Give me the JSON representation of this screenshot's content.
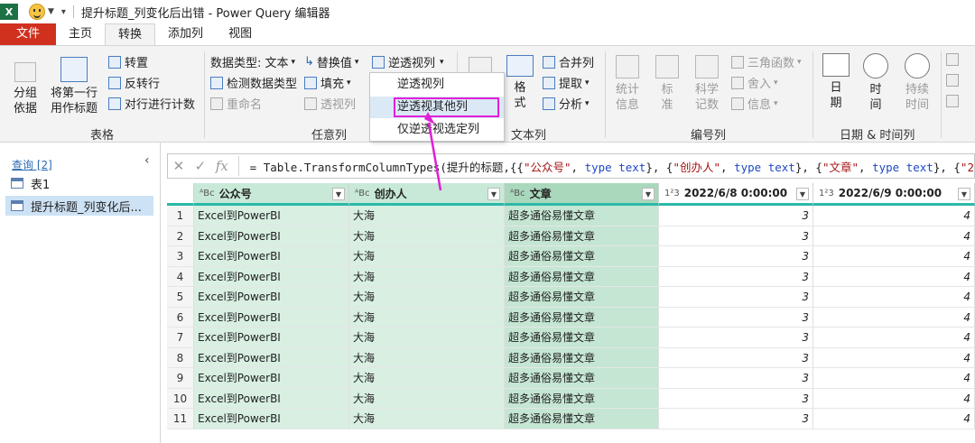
{
  "window": {
    "title": "提升标题_列变化后出错 - Power Query 编辑器",
    "app_logo": "X"
  },
  "tabs": [
    "文件",
    "主页",
    "转换",
    "添加列",
    "视图"
  ],
  "ribbon": {
    "table_group": {
      "label": "表格",
      "group_by": "分组\n依据",
      "use_first_row": "将第一行\n用作标题",
      "transpose": "转置",
      "reverse_rows": "反转行",
      "count_rows": "对行进行计数"
    },
    "any_column_group": {
      "label": "任意列",
      "data_type": "数据类型: 文本",
      "replace_values": "替换值",
      "unpivot_columns": "逆透视列",
      "detect_type": "检测数据类型",
      "fill": "填充",
      "rename": "重命名",
      "pivot": "透视列"
    },
    "text_group": {
      "label": "文本列",
      "format": "格\n式",
      "merge_columns": "合并列",
      "extract": "提取",
      "parse": "分析"
    },
    "number_group": {
      "label": "编号列",
      "statistics": "统计\n信息",
      "standard": "标\n准",
      "scientific": "科学\n记数",
      "trigonometry": "三角函数",
      "rounding": "舍入",
      "information": "信息"
    },
    "datetime_group": {
      "label": "日期 & 时间列",
      "date": "日\n期",
      "time": "时\n间",
      "duration": "持续\n时间"
    }
  },
  "dropdown_menu": {
    "items": [
      "逆透视列",
      "逆透视其他列",
      "仅逆透视选定列"
    ],
    "highlighted_index": 1
  },
  "queries_pane": {
    "title": "查询 [2]",
    "items": [
      "表1",
      "提升标题_列变化后..."
    ],
    "selected_index": 1
  },
  "formula_bar": {
    "prefix": "= Table.TransformColumnTypes(提升的标题,{{",
    "segments": [
      {
        "t": "\"公众号\"",
        "c": "str"
      },
      {
        "t": ", ",
        "c": ""
      },
      {
        "t": "type",
        "c": "kw"
      },
      {
        "t": " ",
        "c": ""
      },
      {
        "t": "text",
        "c": "kw"
      },
      {
        "t": "}, {",
        "c": ""
      },
      {
        "t": "\"创办人\"",
        "c": "str"
      },
      {
        "t": ", ",
        "c": ""
      },
      {
        "t": "type",
        "c": "kw"
      },
      {
        "t": " ",
        "c": ""
      },
      {
        "t": "text",
        "c": "kw"
      },
      {
        "t": "}, {",
        "c": ""
      },
      {
        "t": "\"文章\"",
        "c": "str"
      },
      {
        "t": ", ",
        "c": ""
      },
      {
        "t": "type",
        "c": "kw"
      },
      {
        "t": " ",
        "c": ""
      },
      {
        "t": "text",
        "c": "kw"
      },
      {
        "t": "}, {",
        "c": ""
      },
      {
        "t": "\"2",
        "c": "str"
      }
    ]
  },
  "table": {
    "columns": [
      {
        "name": "公众号",
        "type": "ABC",
        "state": "green"
      },
      {
        "name": "创办人",
        "type": "ABC",
        "state": "green"
      },
      {
        "name": "文章",
        "type": "ABC",
        "state": "sel"
      },
      {
        "name": "2022/6/8 0:00:00",
        "type": "123",
        "state": "plain"
      },
      {
        "name": "2022/6/9 0:00:00",
        "type": "123",
        "state": "plain"
      }
    ],
    "rows": [
      [
        "1",
        "Excel到PowerBI",
        "大海",
        "超多通俗易懂文章",
        "3",
        "4"
      ],
      [
        "2",
        "Excel到PowerBI",
        "大海",
        "超多通俗易懂文章",
        "3",
        "4"
      ],
      [
        "3",
        "Excel到PowerBI",
        "大海",
        "超多通俗易懂文章",
        "3",
        "4"
      ],
      [
        "4",
        "Excel到PowerBI",
        "大海",
        "超多通俗易懂文章",
        "3",
        "4"
      ],
      [
        "5",
        "Excel到PowerBI",
        "大海",
        "超多通俗易懂文章",
        "3",
        "4"
      ],
      [
        "6",
        "Excel到PowerBI",
        "大海",
        "超多通俗易懂文章",
        "3",
        "4"
      ],
      [
        "7",
        "Excel到PowerBI",
        "大海",
        "超多通俗易懂文章",
        "3",
        "4"
      ],
      [
        "8",
        "Excel到PowerBI",
        "大海",
        "超多通俗易懂文章",
        "3",
        "4"
      ],
      [
        "9",
        "Excel到PowerBI",
        "大海",
        "超多通俗易懂文章",
        "3",
        "4"
      ],
      [
        "10",
        "Excel到PowerBI",
        "大海",
        "超多通俗易懂文章",
        "3",
        "4"
      ],
      [
        "11",
        "Excel到PowerBI",
        "大海",
        "超多通俗易懂文章",
        "3",
        "4"
      ]
    ]
  },
  "colors": {
    "file_tab": "#d0311f",
    "annotation": "#e020d8",
    "header_accent": "#2bb9a8",
    "selected_column": "#c5e6d3"
  },
  "icons": [
    "excel-logo-icon",
    "smiley-icon",
    "table-icon",
    "clock-icon",
    "calendar-icon"
  ]
}
